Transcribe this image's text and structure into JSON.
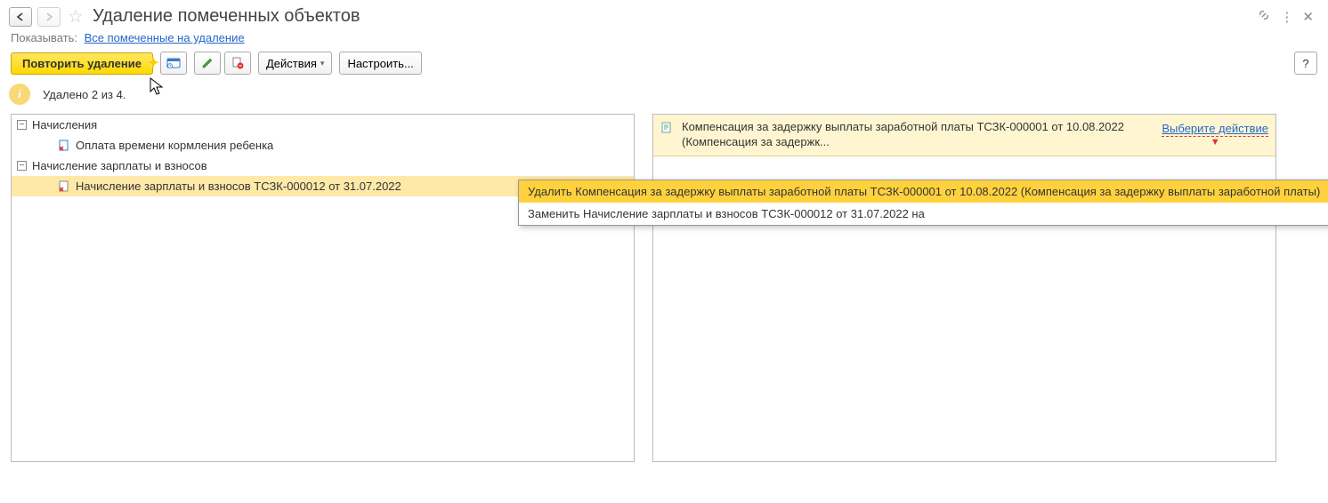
{
  "header": {
    "title": "Удаление помеченных объектов"
  },
  "filter": {
    "label": "Показывать:",
    "link": "Все помеченные на удаление"
  },
  "toolbar": {
    "repeat_delete": "Повторить удаление",
    "actions": "Действия",
    "configure": "Настроить..."
  },
  "info": {
    "message": "Удалено 2 из 4."
  },
  "tree": {
    "group1": "Начисления",
    "item1": "Оплата времени кормления ребенка",
    "group2": "Начисление зарплаты и взносов",
    "item2": "Начисление зарплаты и взносов ТСЗК-000012 от 31.07.2022"
  },
  "right": {
    "description": "Компенсация за задержку выплаты заработной платы ТСЗК-000001 от 10.08.2022 (Компенсация за задержк...",
    "action_label": "Выберите действие"
  },
  "popup": {
    "item1": "Удалить Компенсация за задержку выплаты заработной платы ТСЗК-000001 от 10.08.2022 (Компенсация за задержку выплаты заработной платы)",
    "item2": "Заменить Начисление зарплаты и взносов ТСЗК-000012 от 31.07.2022 на"
  },
  "help": "?"
}
